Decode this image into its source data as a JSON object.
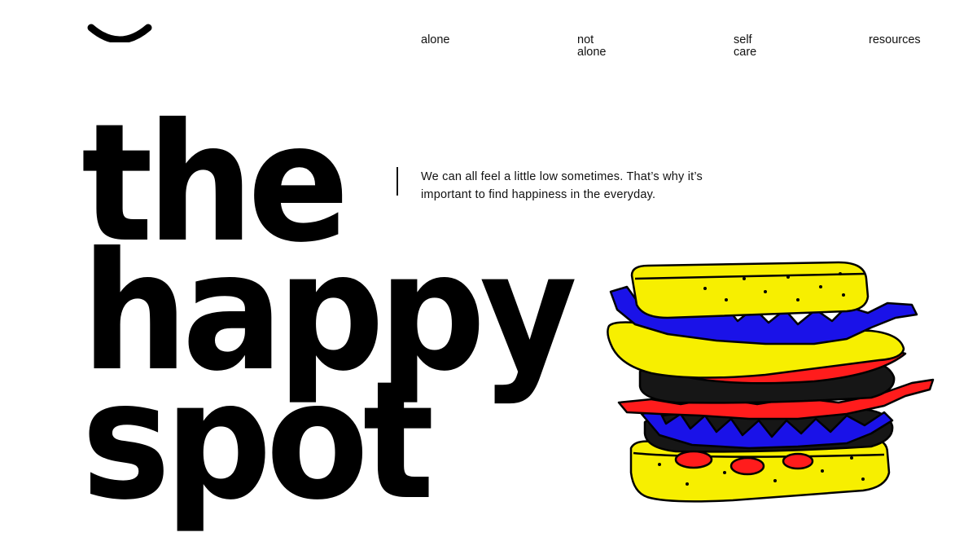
{
  "nav": {
    "items": [
      {
        "label": "alone"
      },
      {
        "label": "not\nalone"
      },
      {
        "label": "self\ncare"
      },
      {
        "label": "resources"
      }
    ]
  },
  "hero": {
    "lines": [
      "the",
      "happy",
      "spot"
    ]
  },
  "tagline": "We can all feel a little low sometimes. That’s why it’s important to find happiness in the everyday.",
  "icons": {
    "logo": "smile-logo-icon",
    "illustration": "sandwich-illustration"
  },
  "colors": {
    "background": "#ffffff",
    "text": "#000000",
    "bread": "#f7ef00",
    "lettuce": "#1a12e8",
    "tomato": "#ff1c1c",
    "patty": "#161616"
  }
}
